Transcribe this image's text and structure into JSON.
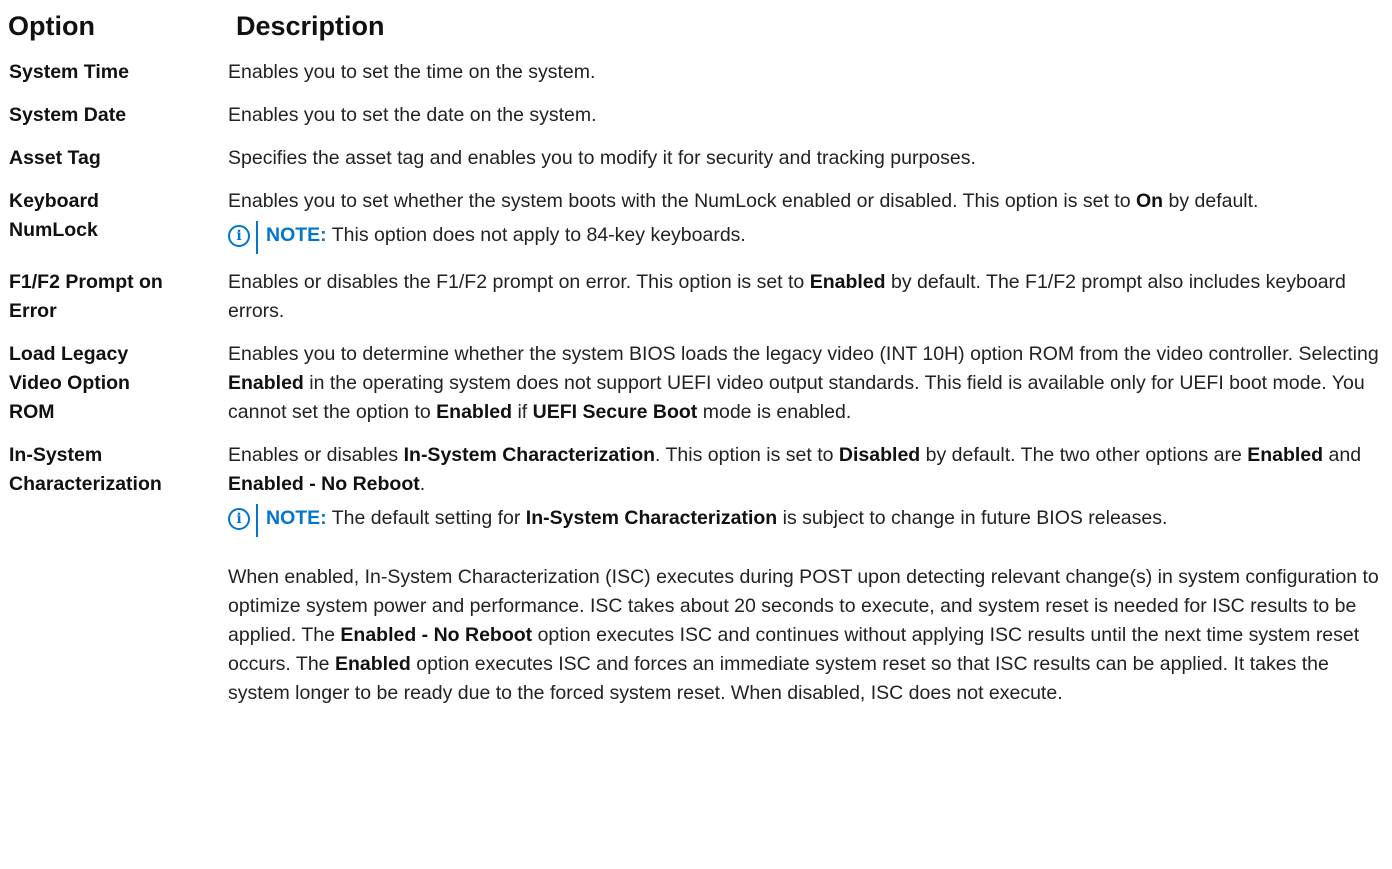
{
  "header": {
    "option": "Option",
    "description": "Description"
  },
  "rows": [
    {
      "option": "System Time",
      "desc": "Enables you to set the time on the system."
    },
    {
      "option": "System Date",
      "desc": "Enables you to set the date on the system."
    },
    {
      "option": "Asset Tag",
      "desc": "Specifies the asset tag and enables you to modify it for security and tracking purposes."
    },
    {
      "option_line1": "Keyboard",
      "option_line2": "NumLock",
      "desc_a": "Enables you to set whether the system boots with the NumLock enabled or disabled. This option is set to",
      "desc_b": "On",
      "desc_c": "by default.",
      "note_label": "NOTE:",
      "note_text": "This option does not apply to 84-key keyboards."
    },
    {
      "option_line1": "F1/F2 Prompt on",
      "option_line2": "Error",
      "desc_a": "Enables or disables the F1/F2 prompt on error. This option is set to",
      "desc_b": "Enabled",
      "desc_c": "by default. The F1/F2 prompt also includes keyboard errors."
    },
    {
      "option_line1": "Load Legacy",
      "option_line2": "Video Option",
      "option_line3": "ROM",
      "desc_a": "Enables you to determine whether the system BIOS loads the legacy video (INT 10H) option ROM from the video controller. Selecting",
      "desc_b": "Enabled",
      "desc_c": "in the operating system does not support UEFI video output standards. This field is available only for UEFI boot mode. You cannot set the option to",
      "desc_d": "Enabled",
      "desc_e": "if",
      "desc_f": "UEFI Secure Boot",
      "desc_g": "mode is enabled."
    },
    {
      "option_line1": "In-System",
      "option_line2": "Characterization",
      "desc_a": "Enables or disables",
      "desc_b": "In-System Characterization",
      "desc_c": ". This option is set to",
      "desc_d": "Disabled",
      "desc_e": "by default. The two other options are",
      "desc_f": "Enabled",
      "desc_g": "and",
      "desc_h": "Enabled - No Reboot",
      "desc_i": ".",
      "note_label": "NOTE:",
      "note_a": "The default setting for",
      "note_b": "In-System Characterization",
      "note_c": "is subject to change in future BIOS releases.",
      "para_a": "When enabled, In-System Characterization (ISC) executes during POST upon detecting relevant change(s) in system configuration to optimize system power and performance. ISC takes about 20 seconds to execute, and system reset is needed for ISC results to be applied. The",
      "para_b": "Enabled - No Reboot",
      "para_c": "option executes ISC and continues without applying ISC results until the next time system reset occurs. The",
      "para_d": "Enabled",
      "para_e": "option executes ISC and forces an immediate system reset so that ISC results can be applied. It takes the system longer to be ready due to the forced system reset. When disabled, ISC does not execute."
    }
  ],
  "icons": {
    "info_glyph": "i",
    "accent_color": "#0076ce"
  }
}
